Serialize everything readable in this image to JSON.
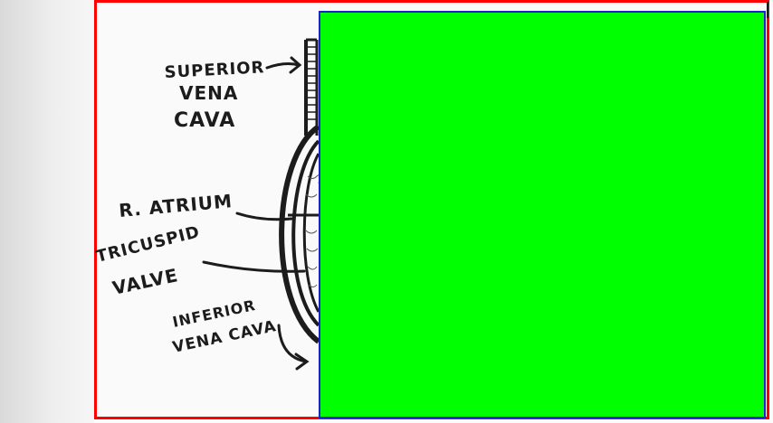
{
  "labels": {
    "superior_vena_cava": [
      "SUPERIOR",
      "VENA",
      "CAVA"
    ],
    "right_atrium": "R. ATRIUM",
    "tricuspid_valve": [
      "TRICUSPID",
      "VALVE"
    ],
    "inferior_vena_cava": [
      "INFERIOR",
      "VENA CAVA"
    ]
  },
  "colors": {
    "frame_border": "#ff0000",
    "overlay_fill": "#00ff00",
    "overlay_border": "#2020d0",
    "ink": "#1c1c1c"
  }
}
